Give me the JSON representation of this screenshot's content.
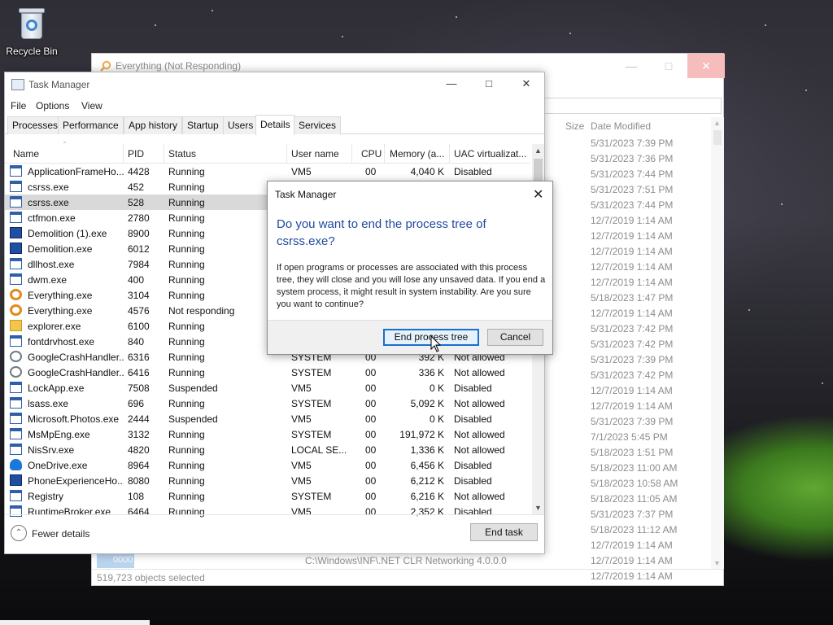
{
  "desktop": {
    "recycle_bin_label": "Recycle Bin"
  },
  "everything_window": {
    "title": "Everything (Not Responding)",
    "col_size": "Size",
    "col_date": "Date Modified",
    "dates": [
      "5/31/2023 7:39 PM",
      "5/31/2023 7:36 PM",
      "5/31/2023 7:44 PM",
      "5/31/2023 7:51 PM",
      "5/31/2023 7:44 PM",
      "12/7/2019 1:14 AM",
      "12/7/2019 1:14 AM",
      "12/7/2019 1:14 AM",
      "12/7/2019 1:14 AM",
      "12/7/2019 1:14 AM",
      "5/18/2023 1:47 PM",
      "12/7/2019 1:14 AM",
      "5/31/2023 7:42 PM",
      "5/31/2023 7:42 PM",
      "5/31/2023 7:39 PM",
      "5/31/2023 7:42 PM",
      "12/7/2019 1:14 AM",
      "12/7/2019 1:14 AM",
      "5/31/2023 7:39 PM",
      "7/1/2023 5:45 PM",
      "5/18/2023 1:51 PM",
      "5/18/2023 11:00 AM",
      "5/18/2023 10:58 AM",
      "5/18/2023 11:05 AM",
      "5/31/2023 7:37 PM",
      "5/18/2023 11:12 AM",
      "12/7/2019 1:14 AM",
      "12/7/2019 1:14 AM",
      "12/7/2019 1:14 AM"
    ],
    "selected_item": "0000",
    "path_row": "C:\\Windows\\INF\\.NET CLR Networking 4.0.0.0",
    "status": "519,723 objects selected"
  },
  "task_manager": {
    "title": "Task Manager",
    "menu": [
      "File",
      "Options",
      "View"
    ],
    "tabs": [
      "Processes",
      "Performance",
      "App history",
      "Startup",
      "Users",
      "Details",
      "Services"
    ],
    "active_tab": "Details",
    "columns": {
      "name": "Name",
      "pid": "PID",
      "status": "Status",
      "user": "User name",
      "cpu": "CPU",
      "memory": "Memory (a...",
      "uac": "UAC virtualizat..."
    },
    "rows": [
      {
        "name": "ApplicationFrameHo...",
        "pid": "4428",
        "status": "Running",
        "user": "VM5",
        "cpu": "00",
        "mem": "4,040 K",
        "uac": "Disabled",
        "icon": "app"
      },
      {
        "name": "csrss.exe",
        "pid": "452",
        "status": "Running",
        "user": "",
        "cpu": "",
        "mem": "",
        "uac": "",
        "icon": "app"
      },
      {
        "name": "csrss.exe",
        "pid": "528",
        "status": "Running",
        "user": "",
        "cpu": "",
        "mem": "",
        "uac": "",
        "icon": "app",
        "selected": true
      },
      {
        "name": "ctfmon.exe",
        "pid": "2780",
        "status": "Running",
        "user": "",
        "cpu": "",
        "mem": "",
        "uac": "",
        "icon": "app"
      },
      {
        "name": "Demolition (1).exe",
        "pid": "8900",
        "status": "Running",
        "user": "",
        "cpu": "",
        "mem": "",
        "uac": "",
        "icon": "blue"
      },
      {
        "name": "Demolition.exe",
        "pid": "6012",
        "status": "Running",
        "user": "",
        "cpu": "",
        "mem": "",
        "uac": "",
        "icon": "blue"
      },
      {
        "name": "dllhost.exe",
        "pid": "7984",
        "status": "Running",
        "user": "",
        "cpu": "",
        "mem": "",
        "uac": "",
        "icon": "app"
      },
      {
        "name": "dwm.exe",
        "pid": "400",
        "status": "Running",
        "user": "",
        "cpu": "",
        "mem": "",
        "uac": "",
        "icon": "app"
      },
      {
        "name": "Everything.exe",
        "pid": "3104",
        "status": "Running",
        "user": "",
        "cpu": "",
        "mem": "",
        "uac": "",
        "icon": "mag"
      },
      {
        "name": "Everything.exe",
        "pid": "4576",
        "status": "Not responding",
        "user": "",
        "cpu": "",
        "mem": "",
        "uac": "",
        "icon": "mag"
      },
      {
        "name": "explorer.exe",
        "pid": "6100",
        "status": "Running",
        "user": "",
        "cpu": "",
        "mem": "",
        "uac": "",
        "icon": "folder"
      },
      {
        "name": "fontdrvhost.exe",
        "pid": "840",
        "status": "Running",
        "user": "",
        "cpu": "",
        "mem": "",
        "uac": "",
        "icon": "app"
      },
      {
        "name": "GoogleCrashHandler...",
        "pid": "6316",
        "status": "Running",
        "user": "SYSTEM",
        "cpu": "00",
        "mem": "392 K",
        "uac": "Not allowed",
        "icon": "gear"
      },
      {
        "name": "GoogleCrashHandler...",
        "pid": "6416",
        "status": "Running",
        "user": "SYSTEM",
        "cpu": "00",
        "mem": "336 K",
        "uac": "Not allowed",
        "icon": "gear"
      },
      {
        "name": "LockApp.exe",
        "pid": "7508",
        "status": "Suspended",
        "user": "VM5",
        "cpu": "00",
        "mem": "0 K",
        "uac": "Disabled",
        "icon": "app"
      },
      {
        "name": "lsass.exe",
        "pid": "696",
        "status": "Running",
        "user": "SYSTEM",
        "cpu": "00",
        "mem": "5,092 K",
        "uac": "Not allowed",
        "icon": "app"
      },
      {
        "name": "Microsoft.Photos.exe",
        "pid": "2444",
        "status": "Suspended",
        "user": "VM5",
        "cpu": "00",
        "mem": "0 K",
        "uac": "Disabled",
        "icon": "app"
      },
      {
        "name": "MsMpEng.exe",
        "pid": "3132",
        "status": "Running",
        "user": "SYSTEM",
        "cpu": "00",
        "mem": "191,972 K",
        "uac": "Not allowed",
        "icon": "app"
      },
      {
        "name": "NisSrv.exe",
        "pid": "4820",
        "status": "Running",
        "user": "LOCAL SE...",
        "cpu": "00",
        "mem": "1,336 K",
        "uac": "Not allowed",
        "icon": "app"
      },
      {
        "name": "OneDrive.exe",
        "pid": "8964",
        "status": "Running",
        "user": "VM5",
        "cpu": "00",
        "mem": "6,456 K",
        "uac": "Disabled",
        "icon": "cloud"
      },
      {
        "name": "PhoneExperienceHo...",
        "pid": "8080",
        "status": "Running",
        "user": "VM5",
        "cpu": "00",
        "mem": "6,212 K",
        "uac": "Disabled",
        "icon": "blue"
      },
      {
        "name": "Registry",
        "pid": "108",
        "status": "Running",
        "user": "SYSTEM",
        "cpu": "00",
        "mem": "6,216 K",
        "uac": "Not allowed",
        "icon": "app"
      },
      {
        "name": "RuntimeBroker.exe",
        "pid": "6464",
        "status": "Running",
        "user": "VM5",
        "cpu": "00",
        "mem": "2,352 K",
        "uac": "Disabled",
        "icon": "app"
      }
    ],
    "fewer_details": "Fewer details",
    "end_task": "End task"
  },
  "dialog": {
    "title": "Task Manager",
    "question": "Do you want to end the process tree of csrss.exe?",
    "message": "If open programs or processes are associated with this process tree, they will close and you will lose any unsaved data. If you end a system process, it might result in system instability. Are you sure you want to continue?",
    "confirm": "End process tree",
    "cancel": "Cancel"
  }
}
